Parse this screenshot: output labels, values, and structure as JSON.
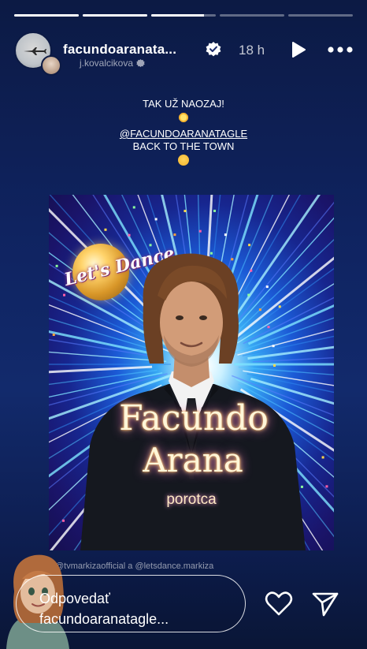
{
  "progress": [
    {
      "state": "seen",
      "fraction": 1.0
    },
    {
      "state": "seen",
      "fraction": 1.0
    },
    {
      "state": "current",
      "fraction": 0.82
    },
    {
      "state": "unseen",
      "fraction": 0.0
    },
    {
      "state": "unseen",
      "fraction": 0.0
    }
  ],
  "header": {
    "username": "facundoaranata...",
    "time": "18 h",
    "sub_username": "j.kovalcikova",
    "icons": [
      "verified-badge-icon",
      "play-icon",
      "more-icon"
    ]
  },
  "caption": {
    "line1": "TAK UŽ NAOZAJ!",
    "mention": "@FACUNDOARANATAGLE",
    "line3": "BACK TO THE TOWN"
  },
  "poster": {
    "logo": "Let's Dance",
    "first_name": "Facundo",
    "last_name": "Arana",
    "role": "porotca"
  },
  "tags": "@tvmarkizaofficial a @letsdance.markiza",
  "reply": {
    "placeholder_line1": "Odpovedať",
    "placeholder_line2": "facundoaranatagle..."
  },
  "colors": {
    "background_top": "#0c1a44",
    "background_mid": "#122a6c",
    "poster_glow": "#37a7f3"
  }
}
